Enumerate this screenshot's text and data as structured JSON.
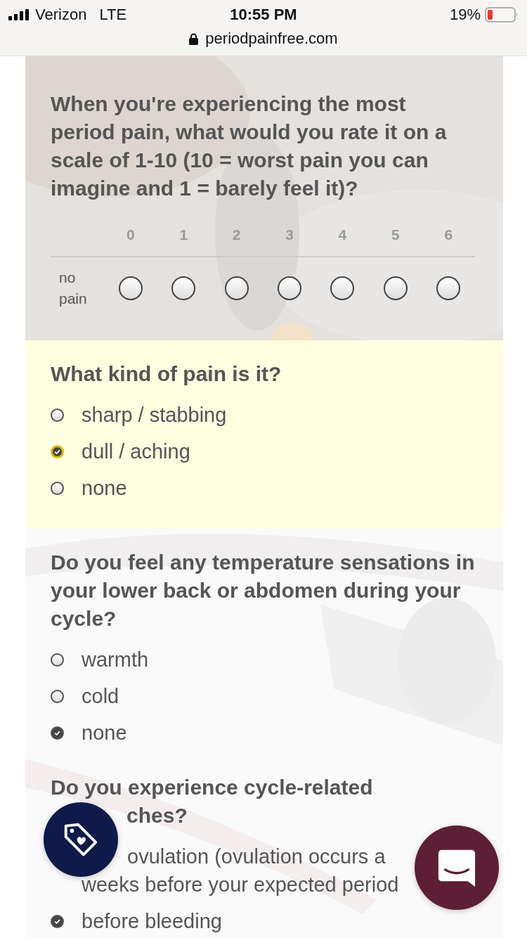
{
  "status_bar": {
    "carrier": "Verizon",
    "network": "LTE",
    "time": "10:55 PM",
    "battery": "19%",
    "url": "periodpainfree.com"
  },
  "questions": [
    {
      "kind": "scale",
      "highlighted": false,
      "lines": [
        "When you're experiencing the most period pain, what would you rate it on a scale of 1-10 (10 = worst pain you can imagine and 1 = barely feel it)?"
      ],
      "row_label": "no pain",
      "columns": [
        {
          "label": "0",
          "selected": false
        },
        {
          "label": "1",
          "selected": false
        },
        {
          "label": "2",
          "selected": false
        },
        {
          "label": "3",
          "selected": false
        },
        {
          "label": "4",
          "selected": false
        },
        {
          "label": "5",
          "selected": false
        },
        {
          "label": "6",
          "selected": false
        }
      ]
    },
    {
      "kind": "choice",
      "highlighted": true,
      "lines": [
        "What kind of pain is it?"
      ],
      "options": [
        {
          "lines": [
            "sharp / stabbing"
          ],
          "selected": false
        },
        {
          "lines": [
            "dull / aching"
          ],
          "selected": true
        },
        {
          "lines": [
            "none"
          ],
          "selected": false
        }
      ]
    },
    {
      "kind": "choice",
      "highlighted": false,
      "lines": [
        "Do you feel any temperature sensations in your lower back or abdomen during your cycle?"
      ],
      "options": [
        {
          "lines": [
            "warmth"
          ],
          "selected": false
        },
        {
          "lines": [
            "cold"
          ],
          "selected": false
        },
        {
          "lines": [
            "none"
          ],
          "selected": true
        }
      ]
    },
    {
      "kind": "partial",
      "highlighted": false,
      "lines": [
        "Do you experience cycle-related",
        "ches?"
      ],
      "options": [
        {
          "lines": [
            "ovulation (ovulation occurs a",
            "weeks before your expected period"
          ]
        },
        {
          "lines": [
            "before bleeding"
          ],
          "selected": true
        }
      ]
    }
  ]
}
